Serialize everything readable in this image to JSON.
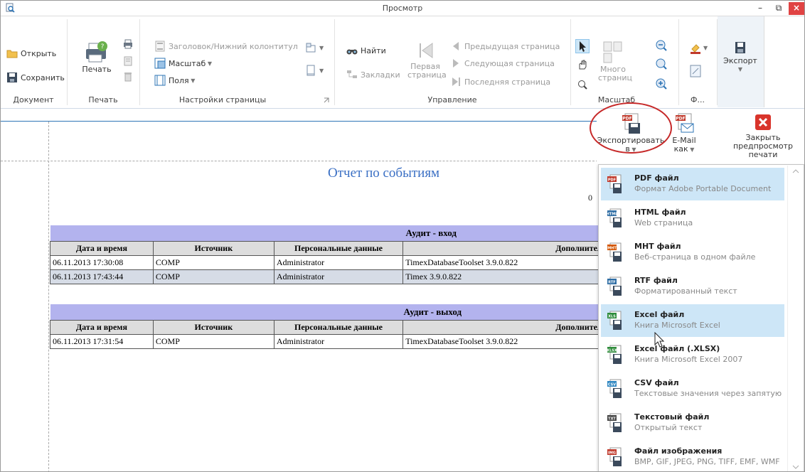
{
  "window": {
    "title": "Просмотр",
    "minimize": "–",
    "maximize": "⧉",
    "close": "×"
  },
  "ribbon": {
    "document": {
      "open": "Открыть",
      "save": "Сохранить",
      "label": "Документ"
    },
    "print": {
      "print": "Печать",
      "label": "Печать"
    },
    "page_setup": {
      "header_footer": "Заголовок/Нижний колонтитул",
      "scale": "Масштаб",
      "margins": "Поля",
      "label": "Настройки страницы"
    },
    "navigation": {
      "find": "Найти",
      "bookmarks": "Закладки",
      "first_page_1": "Первая",
      "first_page_2": "страница",
      "prev": "Предыдущая страница",
      "next": "Следующая страница",
      "last": "Последняя страница",
      "label": "Управление"
    },
    "zoom": {
      "many_pages_1": "Много",
      "many_pages_2": "страниц",
      "label": "Масштаб"
    },
    "background": {
      "label": "Ф..."
    },
    "export": {
      "label": "Экспорт"
    }
  },
  "export_panel": {
    "export_to_1": "Экспортировать",
    "export_to_2": "в",
    "email_1": "E-Mail",
    "email_2": "как",
    "close_1": "Закрыть",
    "close_2": "предпросмотр печати"
  },
  "export_menu": [
    {
      "title": "PDF файл",
      "desc": "Формат Adobe Portable Document",
      "tag": "PDF",
      "color": "#c0392b",
      "highlighted": true
    },
    {
      "title": "HTML файл",
      "desc": "Web страница",
      "tag": "HTML",
      "color": "#2e6da4",
      "highlighted": false
    },
    {
      "title": "MHT файл",
      "desc": "Веб-страница в одном файле",
      "tag": "MHT",
      "color": "#d35400",
      "highlighted": false
    },
    {
      "title": "RTF файл",
      "desc": "Форматированный текст",
      "tag": "RTF",
      "color": "#2e6da4",
      "highlighted": false
    },
    {
      "title": "Excel файл",
      "desc": "Книга Microsoft Excel",
      "tag": "XLS",
      "color": "#2e8b3a",
      "highlighted": true
    },
    {
      "title": "Excel файл (.XLSX)",
      "desc": "Книга Microsoft Excel 2007",
      "tag": "XLSX",
      "color": "#2e8b3a",
      "highlighted": false
    },
    {
      "title": "CSV файл",
      "desc": "Текстовые значения через запятую",
      "tag": "CSV",
      "color": "#2e86c1",
      "highlighted": false
    },
    {
      "title": "Текстовый файл",
      "desc": "Открытый текст",
      "tag": "TXT",
      "color": "#444",
      "highlighted": false
    },
    {
      "title": "Файл изображения",
      "desc": "BMP, GIF, JPEG, PNG, TIFF, EMF, WMF",
      "tag": "IMG",
      "color": "#c0392b",
      "highlighted": false
    }
  ],
  "report": {
    "title": "Отчет по событиям",
    "page_indicator": "0",
    "columns": [
      "Дата и время",
      "Источник",
      "Персональные данные",
      "Дополнительно"
    ],
    "sections": [
      {
        "caption": "Аудит - вход",
        "rows": [
          [
            "06.11.2013 17:30:08",
            "COMP",
            "Administrator",
            "TimexDatabaseToolset 3.9.0.822"
          ],
          [
            "06.11.2013 17:43:44",
            "COMP",
            "Administrator",
            "Timex 3.9.0.822"
          ]
        ]
      },
      {
        "caption": "Аудит - выход",
        "rows": [
          [
            "06.11.2013 17:31:54",
            "COMP",
            "Administrator",
            "TimexDatabaseToolset 3.9.0.822"
          ]
        ]
      }
    ]
  }
}
